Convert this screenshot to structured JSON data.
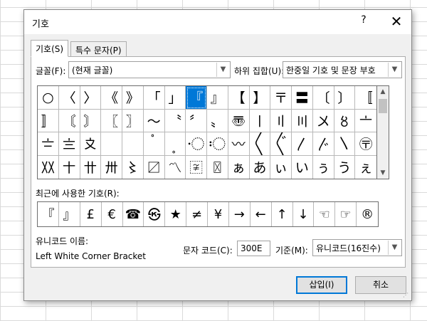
{
  "dialog": {
    "title": "기호",
    "help_label": "?",
    "close_label": "✕"
  },
  "tabs": [
    {
      "label": "기호(S)"
    },
    {
      "label": "특수 문자(P)"
    }
  ],
  "font": {
    "label": "글꼴(F):",
    "value": "(현재 글꼴)"
  },
  "subset": {
    "label": "하위 집합(U):",
    "value": "한중일 기호 및 문장 부호"
  },
  "symbols": [
    "○",
    "〈",
    "〉",
    "《",
    "》",
    "「",
    "」",
    "『",
    "』",
    "【",
    "】",
    "〒",
    "〓",
    "〔",
    "〕",
    "〚",
    "〛",
    "〘",
    "〙",
    "〖",
    "〗",
    "〜",
    "〝",
    "〞",
    "〟",
    "〠",
    "〡",
    "〢",
    "〣",
    "〤",
    "〥",
    "〦",
    "〧",
    "〨",
    "〩",
    "〪",
    "〫",
    "〬",
    "〭",
    "〮",
    "〯",
    "〰",
    "〱",
    "〲",
    "〳",
    "〴",
    "〵",
    "〶",
    "〷",
    "〸",
    "〹",
    "〺",
    "〻",
    "〼",
    "〽",
    "〾",
    "〿",
    "ぁ",
    "あ",
    "ぃ",
    "い",
    "ぅ",
    "う",
    "ぇ"
  ],
  "selected_index": 7,
  "recent": {
    "label": "최근에 사용한 기호(R):",
    "items": [
      "『",
      "』",
      "£",
      "€",
      "☎",
      "㉿",
      "★",
      "≠",
      "¥",
      "→",
      "←",
      "↑",
      "↓",
      "☜",
      "☞",
      "®"
    ]
  },
  "unicode": {
    "label": "유니코드 이름:",
    "name": "Left White Corner Bracket"
  },
  "char_code": {
    "label": "문자 코드(C):",
    "value": "300E"
  },
  "base": {
    "label": "기준(M):",
    "value": "유니코드(16진수)"
  },
  "buttons": {
    "insert": "삽입(I)",
    "cancel": "취소"
  }
}
